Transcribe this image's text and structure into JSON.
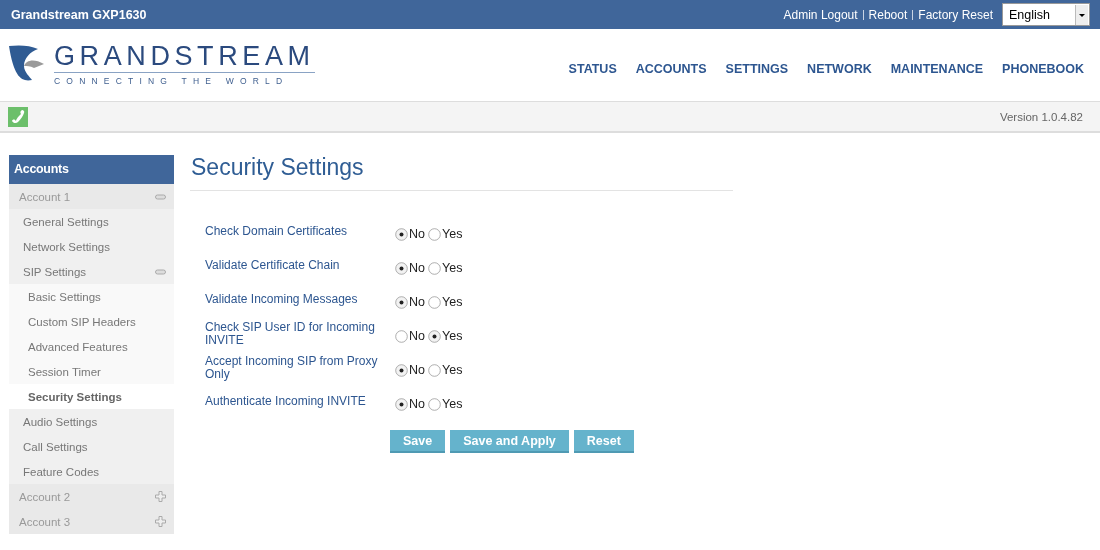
{
  "top_bar": {
    "title": "Grandstream GXP1630",
    "links": [
      "Admin Logout",
      "Reboot",
      "Factory Reset"
    ],
    "language": "English"
  },
  "logo": {
    "name": "GRANDSTREAM",
    "tagline": "CONNECTING THE WORLD"
  },
  "nav": [
    "STATUS",
    "ACCOUNTS",
    "SETTINGS",
    "NETWORK",
    "MAINTENANCE",
    "PHONEBOOK"
  ],
  "toolbar": {
    "version": "Version 1.0.4.82"
  },
  "sidebar": {
    "heading": "Accounts",
    "items": [
      {
        "label": "Account 1",
        "expanded": true,
        "selected": false,
        "children": [
          {
            "label": "General Settings",
            "selected": false
          },
          {
            "label": "Network Settings",
            "selected": false
          },
          {
            "label": "SIP Settings",
            "expanded": true,
            "selected": false,
            "children": [
              {
                "label": "Basic Settings",
                "selected": false
              },
              {
                "label": "Custom SIP Headers",
                "selected": false
              },
              {
                "label": "Advanced Features",
                "selected": false
              },
              {
                "label": "Session Timer",
                "selected": false
              },
              {
                "label": "Security Settings",
                "selected": true
              }
            ]
          },
          {
            "label": "Audio Settings",
            "selected": false
          },
          {
            "label": "Call Settings",
            "selected": false
          },
          {
            "label": "Feature Codes",
            "selected": false
          }
        ]
      },
      {
        "label": "Account 2",
        "expanded": false,
        "selected": false
      },
      {
        "label": "Account 3",
        "expanded": false,
        "selected": false
      }
    ]
  },
  "page_title": "Security Settings",
  "settings": [
    {
      "label": "Check Domain Certificates",
      "options": [
        {
          "label": "No",
          "selected": true
        },
        {
          "label": "Yes",
          "selected": false
        }
      ]
    },
    {
      "label": "Validate Certificate Chain",
      "options": [
        {
          "label": "No",
          "selected": true
        },
        {
          "label": "Yes",
          "selected": false
        }
      ]
    },
    {
      "label": "Validate Incoming Messages",
      "options": [
        {
          "label": "No",
          "selected": true
        },
        {
          "label": "Yes",
          "selected": false
        }
      ]
    },
    {
      "label": "Check SIP User ID for Incoming INVITE",
      "options": [
        {
          "label": "No",
          "selected": false
        },
        {
          "label": "Yes",
          "selected": true
        }
      ]
    },
    {
      "label": "Accept Incoming SIP from Proxy Only",
      "options": [
        {
          "label": "No",
          "selected": true
        },
        {
          "label": "Yes",
          "selected": false
        }
      ]
    },
    {
      "label": "Authenticate Incoming INVITE",
      "options": [
        {
          "label": "No",
          "selected": true
        },
        {
          "label": "Yes",
          "selected": false
        }
      ]
    }
  ],
  "buttons": [
    "Save",
    "Save and Apply",
    "Reset"
  ]
}
